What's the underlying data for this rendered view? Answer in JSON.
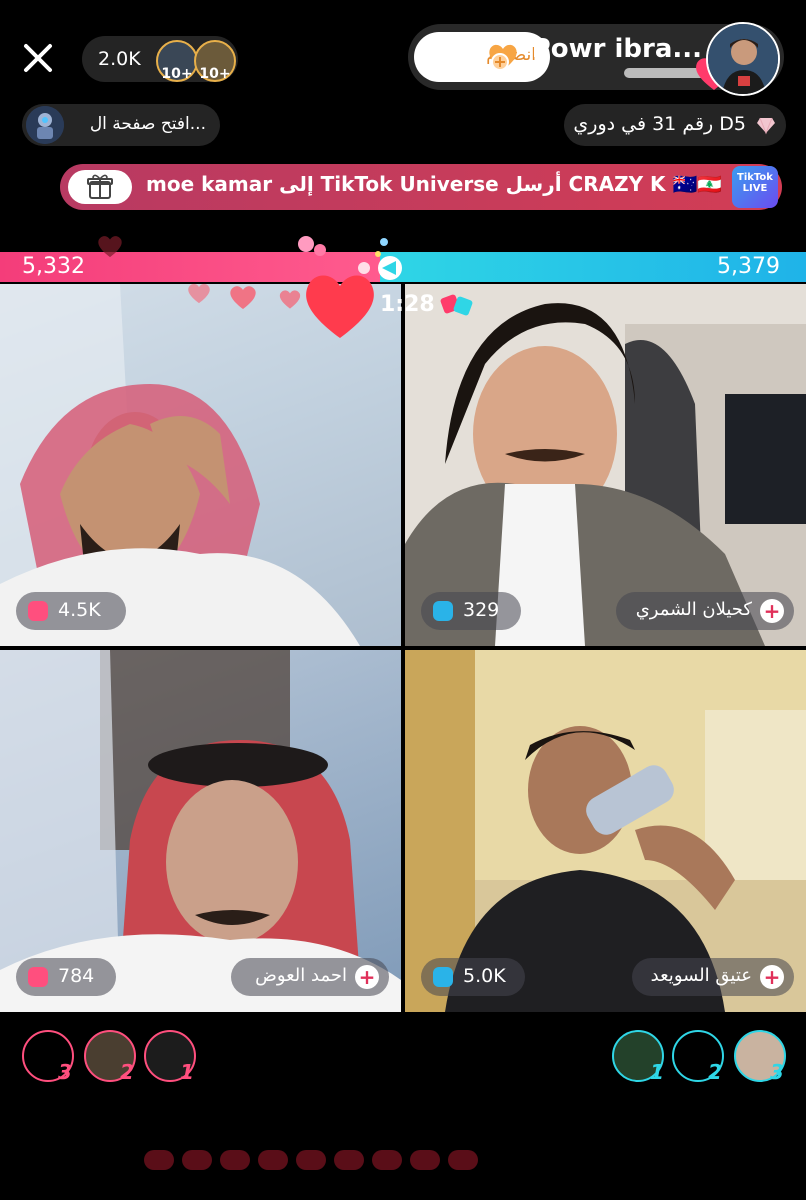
{
  "header": {
    "viewer_count": "2.0K",
    "top_viewers": [
      "10+",
      "10+"
    ],
    "host_name": "Powr ibra...",
    "join_label": "انضمام",
    "rank_text": "رقم 31 في دوري D5",
    "page_link": "افتح صفحة ال..."
  },
  "gift_banner": {
    "text": "moe kamar إلى TikTok Universe أرسل CRAZY K 🇦🇺🇱🇧",
    "badge": "TikTok LIVE"
  },
  "battle": {
    "score_left": "5,332",
    "score_right": "5,379",
    "timer": "1:28"
  },
  "tiles": [
    {
      "gift": "4.5K",
      "name": ""
    },
    {
      "gift": "329",
      "name": "كحيلان الشمري"
    },
    {
      "gift": "784",
      "name": "احمد العوض"
    },
    {
      "gift": "5.0K",
      "name": "عتيق السويعد"
    }
  ],
  "ranks_left": [
    "3",
    "2",
    "1"
  ],
  "ranks_right": [
    "1",
    "2",
    "3"
  ],
  "colors": {
    "pink": "#f43d7a",
    "cyan": "#2fd6e6",
    "banner": "#c93c5a"
  }
}
